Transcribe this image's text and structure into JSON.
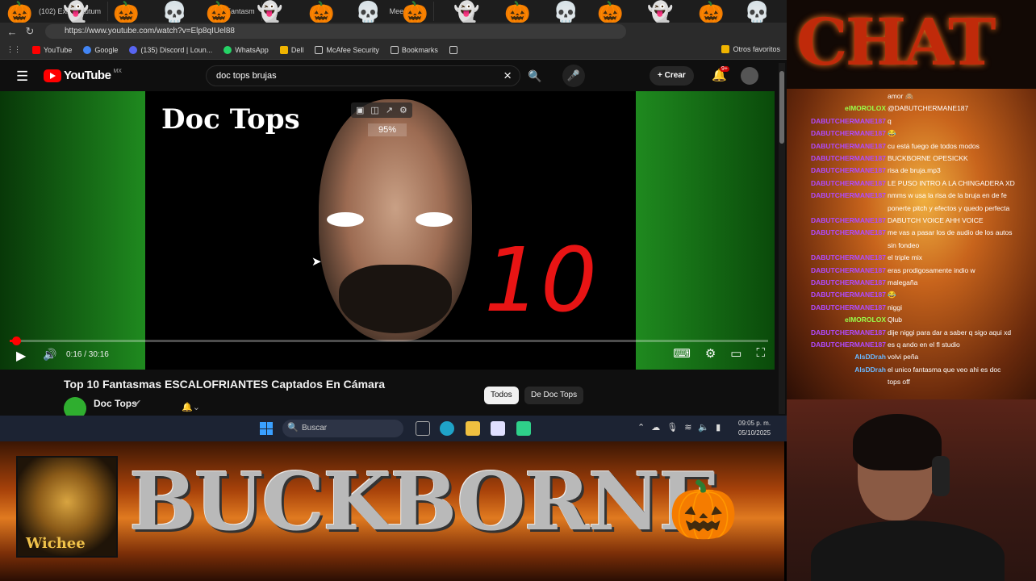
{
  "browser": {
    "tabs": [
      "(102) Exit? - Autum",
      "(10) Fantasm",
      "Meem Birth"
    ],
    "url": "https://www.youtube.com/watch?v=Elp8qIUel88",
    "bookmarks": [
      {
        "label": "YouTube",
        "color": "#ff0000"
      },
      {
        "label": "Google",
        "color": "#4285f4"
      },
      {
        "label": "(135) Discord | Loun...",
        "color": "#5865f2"
      },
      {
        "label": "WhatsApp",
        "color": "#25d366"
      },
      {
        "label": "Dell",
        "color": "#f0b400"
      },
      {
        "label": "McAfee Security",
        "color": "#cccccc"
      },
      {
        "label": "Bookmarks",
        "color": "#cccccc"
      }
    ],
    "other_bookmarks": "Otros favoritos"
  },
  "youtube": {
    "logo": "YouTube",
    "region": "MX",
    "search_query": "doc tops brujas",
    "create_label": "Crear",
    "notif_count": "9+"
  },
  "player": {
    "art_title": "Doc Tops",
    "art_number": "10",
    "volume_pct": "95%",
    "time": "0:16 / 30:16",
    "progress": 0.009
  },
  "video": {
    "title": "Top 10 Fantasmas ESCALOFRIANTES Captados En Cámara",
    "channel": "Doc Tops",
    "chips": [
      "Todos",
      "De Doc Tops"
    ]
  },
  "taskbar": {
    "search_placeholder": "Buscar",
    "time": "09:05 p. m.",
    "date": "05/10/2025"
  },
  "banner": {
    "logo_text": "Wichee",
    "name": "BUCKBORNE"
  },
  "stream": {
    "chat_title": "CHAT",
    "chat": [
      {
        "user": "",
        "text": "amor 🙈",
        "color": "#ff4fa0"
      },
      {
        "user": "elMOROLOX",
        "text": "@DABUTCHERMANE187",
        "color": "#9aff4a"
      },
      {
        "user": "DABUTCHERMANE187",
        "text": "q",
        "color": "#b04aff"
      },
      {
        "user": "DABUTCHERMANE187",
        "text": "😂",
        "color": "#b04aff"
      },
      {
        "user": "DABUTCHERMANE187",
        "text": "cu está fuego de todos modos",
        "color": "#b04aff"
      },
      {
        "user": "DABUTCHERMANE187",
        "text": "BUCKBORNE OPESICKK",
        "color": "#b04aff"
      },
      {
        "user": "DABUTCHERMANE187",
        "text": "risa de bruja.mp3",
        "color": "#b04aff"
      },
      {
        "user": "DABUTCHERMANE187",
        "text": "LE PUSO INTRO A LA CHINGADERA XD",
        "color": "#b04aff"
      },
      {
        "user": "DABUTCHERMANE187",
        "text": "nmms w usa la risa de la bruja en de fe",
        "color": "#b04aff"
      },
      {
        "user": "",
        "text": "ponerte pitch y efectos y quedo perfecta",
        "color": "#b04aff"
      },
      {
        "user": "DABUTCHERMANE187",
        "text": "DABUTCH VOICE AHH VOICE",
        "color": "#b04aff"
      },
      {
        "user": "DABUTCHERMANE187",
        "text": "me vas a pasar los de audio de los autos",
        "color": "#b04aff"
      },
      {
        "user": "",
        "text": "sin fondeo",
        "color": "#b04aff"
      },
      {
        "user": "DABUTCHERMANE187",
        "text": "el triple mix",
        "color": "#b04aff"
      },
      {
        "user": "DABUTCHERMANE187",
        "text": "eras prodigosamente indio w",
        "color": "#b04aff"
      },
      {
        "user": "DABUTCHERMANE187",
        "text": "malegaña",
        "color": "#b04aff"
      },
      {
        "user": "DABUTCHERMANE187",
        "text": "😂",
        "color": "#b04aff"
      },
      {
        "user": "DABUTCHERMANE187",
        "text": "niggi",
        "color": "#b04aff"
      },
      {
        "user": "elMOROLOX",
        "text": "Qlub",
        "color": "#9aff4a"
      },
      {
        "user": "DABUTCHERMANE187",
        "text": "dije niggi para dar a saber q sigo aqui xd",
        "color": "#b04aff"
      },
      {
        "user": "DABUTCHERMANE187",
        "text": "es q ando en el fl studio",
        "color": "#b04aff"
      },
      {
        "user": "AlsDDrah",
        "text": "volvi peña",
        "color": "#6ab8ff"
      },
      {
        "user": "AlsDDrah",
        "text": "el unico fantasma que veo ahi es doc",
        "color": "#6ab8ff"
      },
      {
        "user": "",
        "text": "tops off",
        "color": "#6ab8ff"
      }
    ]
  }
}
